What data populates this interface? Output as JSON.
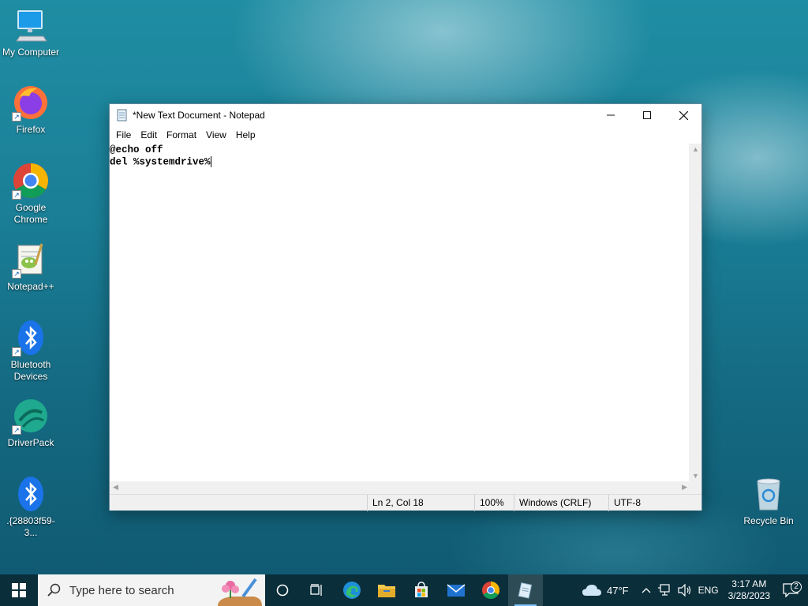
{
  "desktop": {
    "icons": [
      {
        "label": "My Computer"
      },
      {
        "label": "Firefox"
      },
      {
        "label": "Google Chrome"
      },
      {
        "label": "Notepad++"
      },
      {
        "label": "Bluetooth Devices"
      },
      {
        "label": "DriverPack"
      },
      {
        "label": ".{28803f59-3..."
      },
      {
        "label": "Recycle Bin"
      }
    ]
  },
  "notepad": {
    "title": "*New Text Document - Notepad",
    "menu": [
      "File",
      "Edit",
      "Format",
      "View",
      "Help"
    ],
    "content": "@echo off\ndel %systemdrive%",
    "status": {
      "position": "Ln 2, Col 18",
      "zoom": "100%",
      "line_ending": "Windows (CRLF)",
      "encoding": "UTF-8"
    }
  },
  "taskbar": {
    "search_placeholder": "Type here to search",
    "weather": "47°F",
    "language": "ENG",
    "time": "3:17 AM",
    "date": "3/28/2023",
    "notification_count": "2"
  }
}
